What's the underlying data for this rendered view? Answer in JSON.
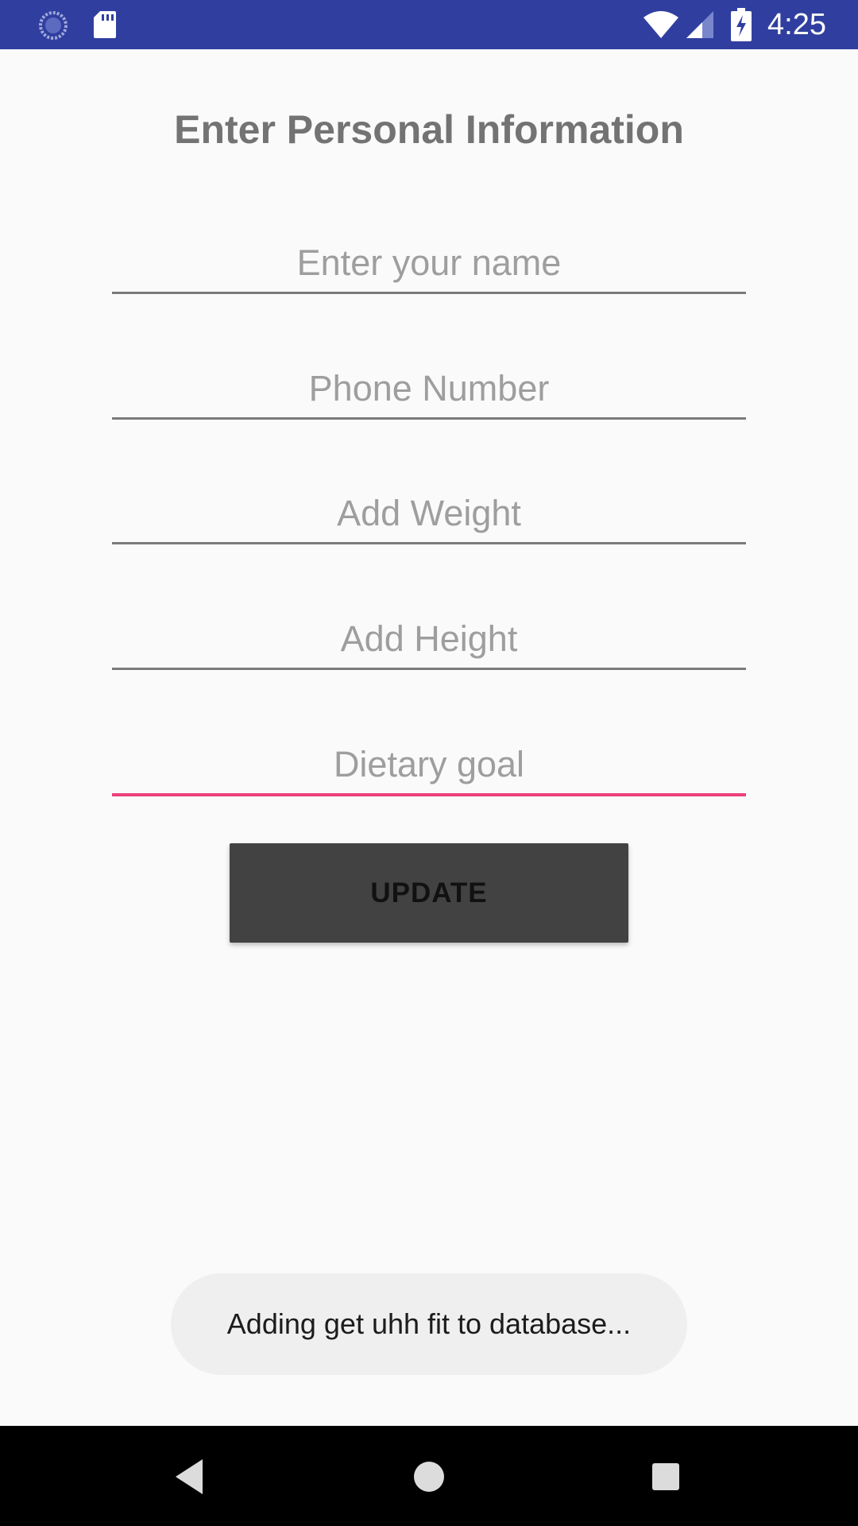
{
  "status_bar": {
    "time": "4:25",
    "background": "#303f9f",
    "icons": [
      "loading-icon",
      "sd-card-icon",
      "wifi-icon",
      "signal-icon",
      "battery-charging-icon"
    ]
  },
  "page": {
    "title": "Enter Personal Information"
  },
  "form": {
    "fields": [
      {
        "placeholder": "Enter your name",
        "value": "",
        "focused": false
      },
      {
        "placeholder": "Phone Number",
        "value": "",
        "focused": false
      },
      {
        "placeholder": "Add Weight",
        "value": "",
        "focused": false
      },
      {
        "placeholder": "Add Height",
        "value": "",
        "focused": false
      },
      {
        "placeholder": "Dietary goal",
        "value": "",
        "focused": true
      }
    ],
    "focus_color": "#ec407a",
    "update_label": "UPDATE"
  },
  "toast": {
    "message": "Adding get uhh fit to database..."
  },
  "nav_bar": {
    "icons": [
      "back-icon",
      "home-icon",
      "recents-icon"
    ]
  }
}
